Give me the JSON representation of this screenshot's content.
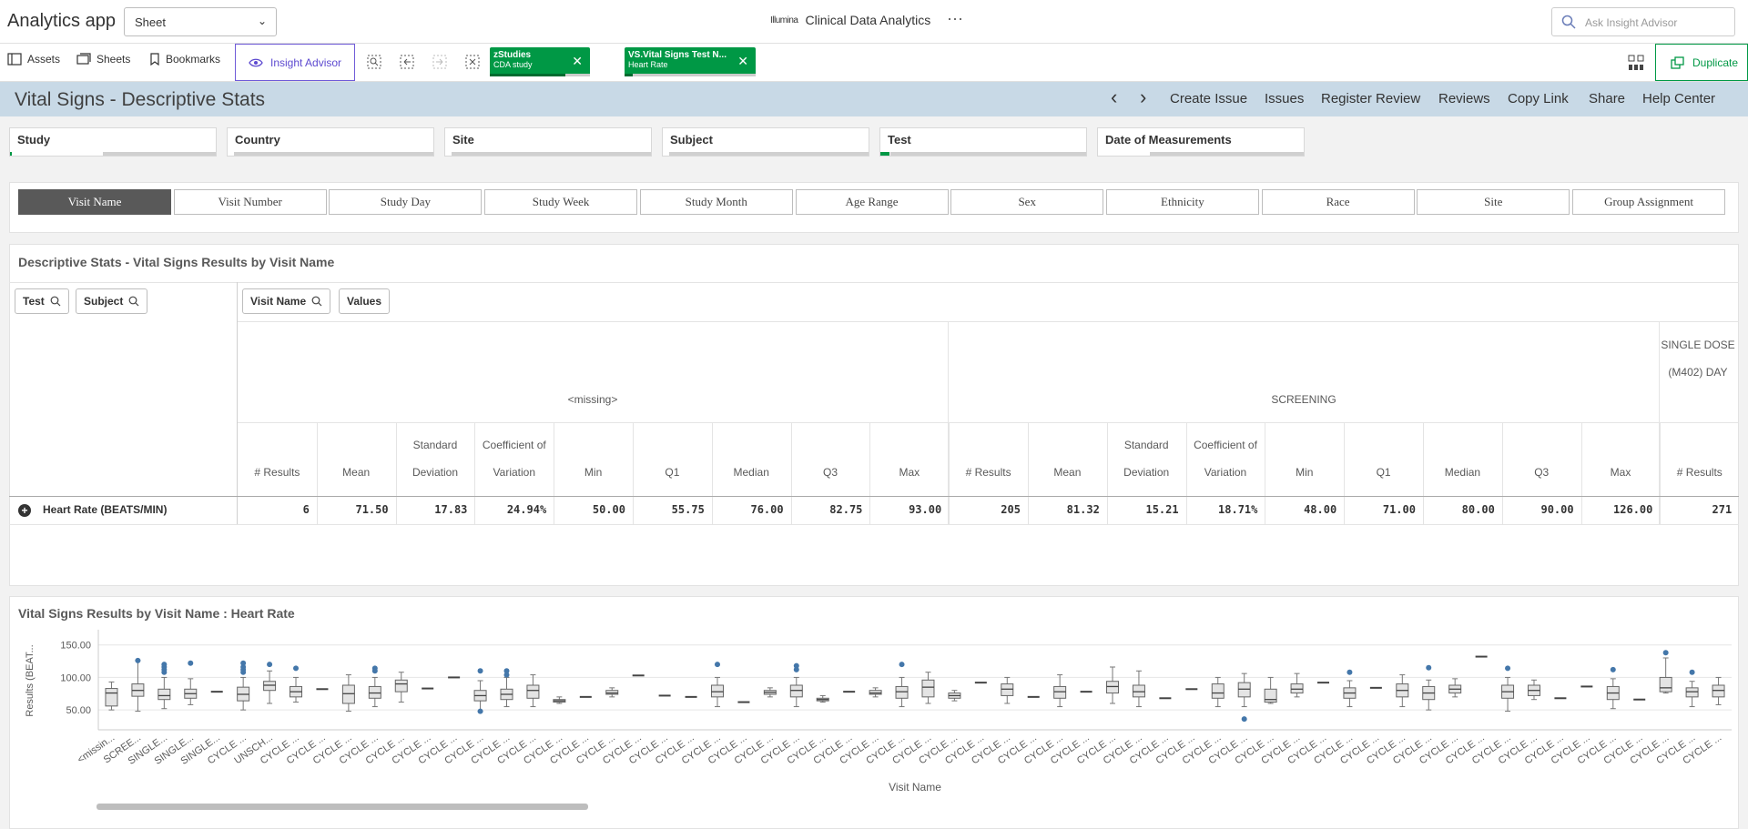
{
  "topbar": {
    "app_title": "Analytics app",
    "sheet_select": "Sheet",
    "brand_logo": "Illumina",
    "brand_title": "Clinical Data Analytics",
    "more": "···",
    "ask_placeholder": "Ask Insight Advisor"
  },
  "toolbar": {
    "assets": "Assets",
    "sheets": "Sheets",
    "bookmarks": "Bookmarks",
    "insight_advisor": "Insight Advisor",
    "chips": [
      {
        "title": "zStudies",
        "value": "CDA study"
      },
      {
        "title": "VS.Vital Signs Test N...",
        "value": "Heart Rate"
      }
    ],
    "duplicate": "Duplicate"
  },
  "titlebar": {
    "title": "Vital Signs - Descriptive Stats",
    "prev": "‹",
    "next": "›",
    "links": [
      "Create Issue",
      "Issues",
      "Register Review",
      "Reviews",
      "Copy Link",
      "Share",
      "Help Center"
    ]
  },
  "filters": [
    "Study",
    "Country",
    "Site",
    "Subject",
    "Test",
    "Date of Measurements"
  ],
  "dimensions": {
    "active": "Visit Name",
    "items": [
      "Visit Name",
      "Visit Number",
      "Study Day",
      "Study Week",
      "Study Month",
      "Age Range",
      "Sex",
      "Ethnicity",
      "Race",
      "Site",
      "Group Assignment"
    ]
  },
  "table": {
    "title": "Descriptive Stats - Vital Signs Results by Visit Name",
    "row_dims": [
      "Test",
      "Subject"
    ],
    "col_dims": [
      "Visit Name",
      "Values"
    ],
    "groups": [
      "<missing>",
      "SCREENING",
      "SINGLE DOSE (M402) DAY"
    ],
    "measures": [
      "# Results",
      "Mean",
      "Standard Deviation",
      "Coefficient of Variation",
      "Min",
      "Q1",
      "Median",
      "Q3",
      "Max"
    ],
    "row_label": "Heart Rate (BEATS/MIN)",
    "row_values": [
      [
        "6",
        "71.50",
        "17.83",
        "24.94%",
        "50.00",
        "55.75",
        "76.00",
        "82.75",
        "93.00"
      ],
      [
        "205",
        "81.32",
        "15.21",
        "18.71%",
        "48.00",
        "71.00",
        "80.00",
        "90.00",
        "126.00"
      ],
      [
        "271"
      ]
    ]
  },
  "chart": {
    "title": "Vital Signs Results by Visit Name : Heart Rate",
    "ylabel": "Results (BEAT...",
    "xlabel": "Visit Name",
    "y_ticks": [
      "150.00",
      "100.00",
      "50.00"
    ]
  },
  "chart_data": {
    "type": "boxplot",
    "title": "Vital Signs Results by Visit Name : Heart Rate",
    "ylabel": "Results (BEAT...",
    "xlabel": "Visit Name",
    "ylim": [
      25,
      165
    ],
    "categories": [
      "<missin...",
      "SCREE...",
      "SINGLE...",
      "SINGLE...",
      "SINGLE...",
      "CYCLE ...",
      "UNSCH...",
      "CYCLE ...",
      "CYCLE ...",
      "CYCLE ...",
      "CYCLE ...",
      "CYCLE ...",
      "CYCLE ...",
      "CYCLE ...",
      "CYCLE ...",
      "CYCLE ...",
      "CYCLE ...",
      "CYCLE ...",
      "CYCLE ...",
      "CYCLE ...",
      "CYCLE ...",
      "CYCLE ...",
      "CYCLE ...",
      "CYCLE ...",
      "CYCLE ...",
      "CYCLE ...",
      "CYCLE ...",
      "CYCLE ...",
      "CYCLE ...",
      "CYCLE ...",
      "CYCLE ...",
      "CYCLE ...",
      "CYCLE ...",
      "CYCLE ...",
      "CYCLE ...",
      "CYCLE ...",
      "CYCLE ...",
      "CYCLE ...",
      "CYCLE ...",
      "CYCLE ...",
      "CYCLE ...",
      "CYCLE ...",
      "CYCLE ...",
      "CYCLE ...",
      "CYCLE ...",
      "CYCLE ...",
      "CYCLE ...",
      "CYCLE ...",
      "CYCLE ...",
      "CYCLE ...",
      "CYCLE ...",
      "CYCLE ...",
      "CYCLE ...",
      "CYCLE ...",
      "CYCLE ...",
      "CYCLE ...",
      "CYCLE ...",
      "CYCLE ...",
      "CYCLE ...",
      "CYCLE ...",
      "CYCLE ...",
      "CYCLE ...",
      "CYCLE ..."
    ],
    "boxes": [
      [
        50,
        56,
        76,
        83,
        93,
        []
      ],
      [
        48,
        71,
        80,
        90,
        126,
        [
          126
        ]
      ],
      [
        52,
        66,
        72,
        82,
        100,
        [
          108,
          112,
          116,
          120
        ]
      ],
      [
        58,
        68,
        75,
        82,
        98,
        [
          122
        ]
      ],
      [
        78,
        78,
        78,
        78,
        78,
        []
      ],
      [
        50,
        64,
        74,
        85,
        100,
        [
          108,
          112,
          116,
          122
        ]
      ],
      [
        60,
        80,
        88,
        94,
        110,
        [
          120
        ]
      ],
      [
        62,
        70,
        78,
        86,
        100,
        [
          114
        ]
      ],
      [
        82,
        82,
        82,
        82,
        82,
        []
      ],
      [
        48,
        60,
        75,
        88,
        104,
        []
      ],
      [
        55,
        68,
        76,
        86,
        100,
        [
          110,
          114
        ]
      ],
      [
        62,
        78,
        90,
        96,
        108,
        []
      ],
      [
        83,
        83,
        83,
        83,
        83,
        []
      ],
      [
        100,
        100,
        100,
        100,
        100,
        []
      ],
      [
        48,
        64,
        72,
        80,
        95,
        [
          48,
          110
        ]
      ],
      [
        55,
        66,
        74,
        82,
        100,
        [
          104,
          110
        ]
      ],
      [
        55,
        68,
        80,
        88,
        104,
        []
      ],
      [
        60,
        62,
        64,
        66,
        70,
        []
      ],
      [
        70,
        70,
        70,
        70,
        70,
        []
      ],
      [
        70,
        74,
        76,
        80,
        84,
        []
      ],
      [
        103,
        103,
        103,
        103,
        103,
        []
      ],
      [
        72,
        72,
        72,
        72,
        72,
        []
      ],
      [
        70,
        70,
        70,
        70,
        70,
        []
      ],
      [
        55,
        70,
        78,
        88,
        100,
        [
          120
        ]
      ],
      [
        62,
        62,
        62,
        62,
        62,
        []
      ],
      [
        70,
        74,
        77,
        80,
        84,
        []
      ],
      [
        55,
        70,
        80,
        88,
        100,
        [
          112,
          118
        ]
      ],
      [
        62,
        64,
        66,
        68,
        72,
        []
      ],
      [
        78,
        78,
        78,
        78,
        78,
        []
      ],
      [
        70,
        74,
        76,
        80,
        84,
        []
      ],
      [
        55,
        68,
        78,
        86,
        100,
        [
          120
        ]
      ],
      [
        60,
        70,
        85,
        96,
        108,
        []
      ],
      [
        64,
        68,
        72,
        76,
        80,
        []
      ],
      [
        92,
        92,
        92,
        92,
        92,
        []
      ],
      [
        60,
        72,
        82,
        90,
        100,
        []
      ],
      [
        70,
        70,
        70,
        70,
        70,
        []
      ],
      [
        55,
        68,
        78,
        86,
        104,
        []
      ],
      [
        78,
        78,
        78,
        78,
        78,
        []
      ],
      [
        60,
        76,
        86,
        94,
        116,
        []
      ],
      [
        55,
        70,
        78,
        88,
        110,
        []
      ],
      [
        68,
        68,
        68,
        68,
        68,
        []
      ],
      [
        82,
        82,
        82,
        82,
        82,
        []
      ],
      [
        55,
        68,
        76,
        90,
        100,
        []
      ],
      [
        55,
        70,
        82,
        92,
        106,
        [
          36
        ]
      ],
      [
        60,
        62,
        66,
        82,
        100,
        []
      ],
      [
        70,
        76,
        82,
        90,
        106,
        []
      ],
      [
        92,
        92,
        92,
        92,
        92,
        []
      ],
      [
        55,
        68,
        76,
        84,
        95,
        [
          108
        ]
      ],
      [
        84,
        84,
        84,
        84,
        84,
        []
      ],
      [
        55,
        70,
        80,
        90,
        104,
        []
      ],
      [
        50,
        66,
        76,
        86,
        96,
        [
          115
        ]
      ],
      [
        70,
        76,
        82,
        88,
        98,
        []
      ],
      [
        132,
        132,
        132,
        132,
        132,
        []
      ],
      [
        48,
        68,
        78,
        88,
        100,
        [
          114
        ]
      ],
      [
        66,
        72,
        80,
        88,
        96,
        []
      ],
      [
        68,
        68,
        68,
        68,
        68,
        []
      ],
      [
        86,
        86,
        86,
        86,
        86,
        []
      ],
      [
        52,
        66,
        76,
        86,
        98,
        [
          112
        ]
      ],
      [
        66,
        66,
        66,
        66,
        66,
        []
      ],
      [
        76,
        78,
        84,
        100,
        130,
        [
          138
        ]
      ],
      [
        55,
        70,
        78,
        84,
        94,
        [
          108
        ]
      ],
      [
        58,
        70,
        80,
        88,
        100,
        []
      ]
    ]
  }
}
